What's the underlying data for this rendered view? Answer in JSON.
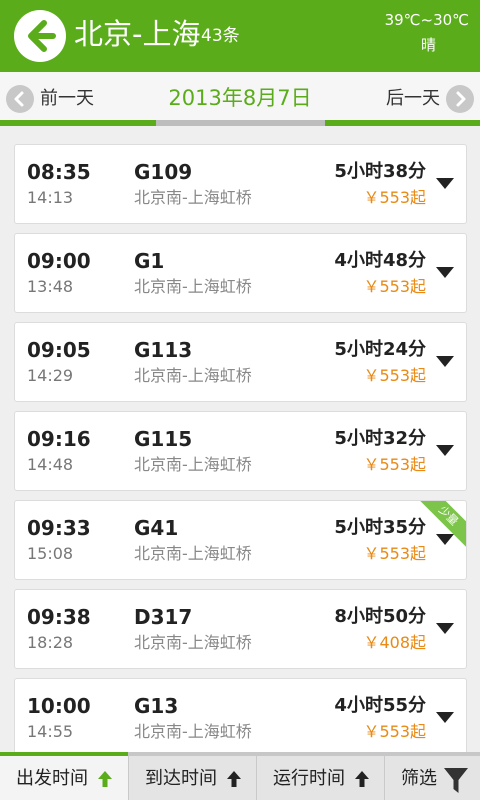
{
  "header": {
    "title": "北京-上海",
    "count": "43条",
    "weather_temp": "39℃~30℃",
    "weather_cond": "晴",
    "back_icon": "back-arrow-icon",
    "brand_color": "#5aac1a"
  },
  "datebar": {
    "prev_label": "前一天",
    "current_date": "2013年8月7日",
    "next_label": "后一天"
  },
  "trains": [
    {
      "dep": "08:35",
      "arr": "14:13",
      "train": "G109",
      "route": "北京南-上海虹桥",
      "duration": "5小时38分",
      "price": "￥553起",
      "badge": ""
    },
    {
      "dep": "09:00",
      "arr": "13:48",
      "train": "G1",
      "route": "北京南-上海虹桥",
      "duration": "4小时48分",
      "price": "￥553起",
      "badge": ""
    },
    {
      "dep": "09:05",
      "arr": "14:29",
      "train": "G113",
      "route": "北京南-上海虹桥",
      "duration": "5小时24分",
      "price": "￥553起",
      "badge": ""
    },
    {
      "dep": "09:16",
      "arr": "14:48",
      "train": "G115",
      "route": "北京南-上海虹桥",
      "duration": "5小时32分",
      "price": "￥553起",
      "badge": ""
    },
    {
      "dep": "09:33",
      "arr": "15:08",
      "train": "G41",
      "route": "北京南-上海虹桥",
      "duration": "5小时35分",
      "price": "￥553起",
      "badge": "少量"
    },
    {
      "dep": "09:38",
      "arr": "18:28",
      "train": "D317",
      "route": "北京南-上海虹桥",
      "duration": "8小时50分",
      "price": "￥408起",
      "badge": ""
    },
    {
      "dep": "10:00",
      "arr": "14:55",
      "train": "G13",
      "route": "北京南-上海虹桥",
      "duration": "4小时55分",
      "price": "￥553起",
      "badge": ""
    }
  ],
  "tabs": [
    {
      "label": "出发时间",
      "icon": "sort-up-arrow-icon",
      "active": true
    },
    {
      "label": "到达时间",
      "icon": "sort-up-arrow-icon",
      "active": false
    },
    {
      "label": "运行时间",
      "icon": "sort-up-arrow-icon",
      "active": false
    },
    {
      "label": "筛选",
      "icon": "filter-funnel-icon",
      "active": false
    }
  ]
}
